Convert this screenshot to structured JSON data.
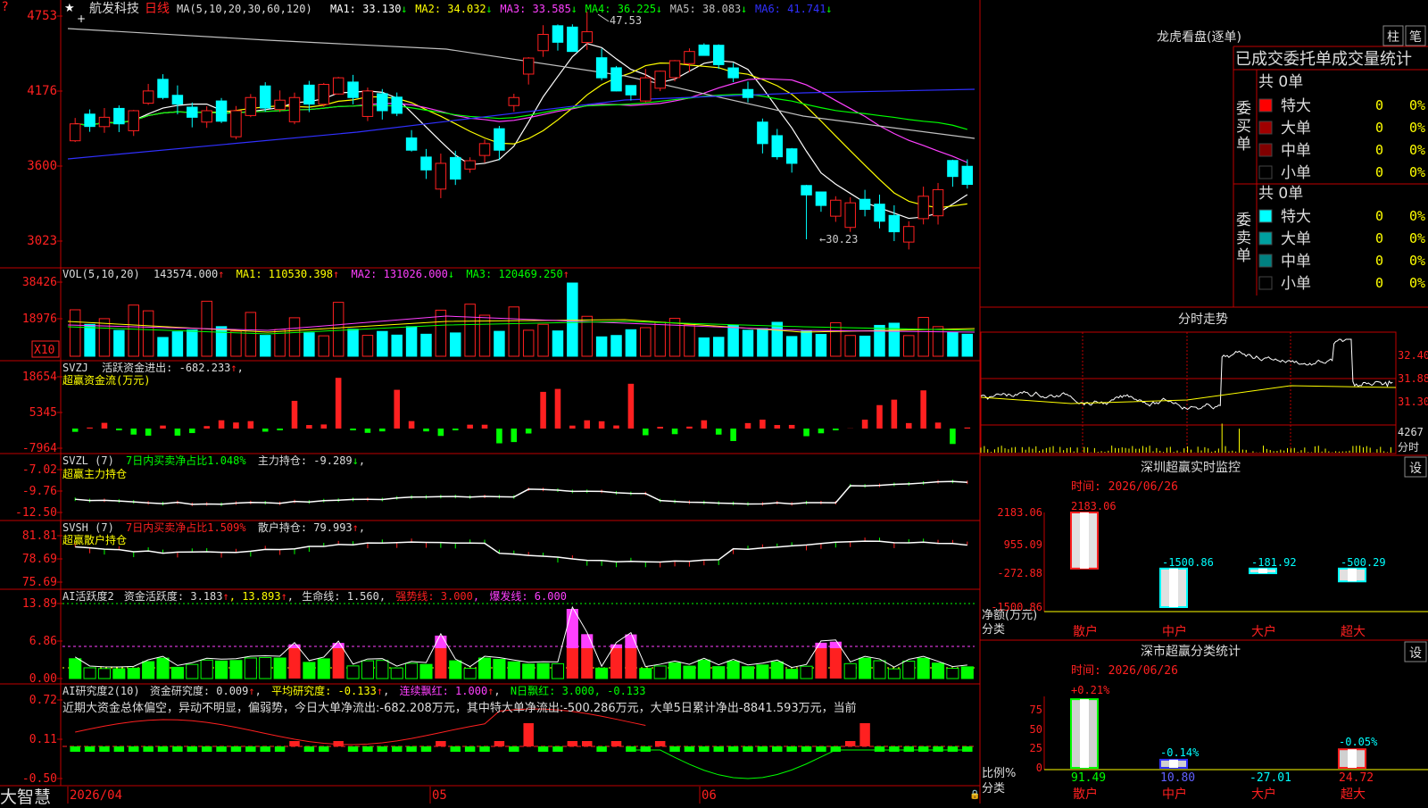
{
  "colors": {
    "up": "#ff2020",
    "down": "#00ffff",
    "grid": "#c00000",
    "ma1": "#ffffff",
    "ma2": "#ffff00",
    "ma3": "#ff40ff",
    "ma4": "#00ff00",
    "ma5": "#c0c0c0",
    "ma6": "#3030ff",
    "orange": "#ff8000"
  },
  "stock": {
    "name": "航发科技",
    "period": "日线",
    "ma_header": "MA(5,10,20,30,60,120)",
    "ma_values": [
      {
        "label": "MA1:",
        "value": "33.130"
      },
      {
        "label": "MA2:",
        "value": "34.032"
      },
      {
        "label": "MA3:",
        "value": "33.585"
      },
      {
        "label": "MA4:",
        "value": "36.225"
      },
      {
        "label": "MA5:",
        "value": "38.083"
      },
      {
        "label": "MA6:",
        "value": "41.741"
      }
    ],
    "high_note": "47.53",
    "low_note": "←30.23",
    "y_ticks": [
      "4753",
      "4176",
      "3600",
      "3023"
    ]
  },
  "vol": {
    "header": "VOL(5,10,20)",
    "value": "143574.000",
    "ma1": "MA1: 110530.398",
    "ma2": "MA2: 131026.000",
    "ma3": "MA3: 120469.250",
    "y_ticks": [
      "38426",
      "18976"
    ],
    "unit": "X10"
  },
  "svzj": {
    "header": "SVZJ",
    "label": "活跃资金进出: -682.233",
    "sub": "超赢资金流(万元)",
    "y_ticks": [
      "18654",
      "5345",
      "-7964"
    ]
  },
  "svzl": {
    "header": "SVZL (7)",
    "pct": "7日内买卖净占比1.048%",
    "main": "主力持仓: -9.289",
    "sub": "超赢主力持仓",
    "y_ticks": [
      "-7.02",
      "-9.76",
      "-12.50"
    ]
  },
  "svsh": {
    "header": "SVSH (7)",
    "pct": "7日内买卖净占比1.509%",
    "retail": "散户持仓: 79.993",
    "sub": "超赢散户持仓",
    "y_ticks": [
      "81.81",
      "78.69",
      "75.69"
    ]
  },
  "ai1": {
    "header": "AI活跃度2",
    "act": "资金活跃度: 3.183",
    "v2": "13.893",
    "life": "生命线: 1.560",
    "strong": "强势线: 3.000",
    "burst": "爆发线: 6.000",
    "y_ticks": [
      "13.89",
      "6.86",
      "0.00"
    ]
  },
  "ai2": {
    "header": "AI研究度2(10)",
    "res": "资金研究度: 0.009",
    "avg": "平均研究度: -0.133",
    "cont": "连续飘红: 1.000",
    "nday": "N日飘红: 3.000, -0.133",
    "comment": "近期大资金总体偏空，异动不明显，偏弱势，今日大单净流出:-682.208万元，其中特大单净流出:-500.286万元，大单5日累计净出-8841.593万元，当前",
    "y_ticks": [
      "0.72",
      "0.11",
      "-0.50"
    ]
  },
  "dates": [
    "2026/04",
    "05",
    "06"
  ],
  "bottom_label": "大智慧",
  "lhb": {
    "title": "龙虎看盘(逐单)",
    "btn1": "柱",
    "btn2": "笔",
    "tab": "已成交委托单成交量统计",
    "buy_side": "委买单",
    "sell_side": "委卖单",
    "total": "共 0单",
    "rows": [
      {
        "name": "特大",
        "count": "0",
        "pct": "0%",
        "color": "#ff0000"
      },
      {
        "name": "大单",
        "count": "0",
        "pct": "0%",
        "color": "#a00000"
      },
      {
        "name": "中单",
        "count": "0",
        "pct": "0%",
        "color": "#800000"
      },
      {
        "name": "小单",
        "count": "0",
        "pct": "0%",
        "color": "#000000"
      }
    ],
    "sell_rows": [
      {
        "name": "特大",
        "count": "0",
        "pct": "0%",
        "color": "#00ffff"
      },
      {
        "name": "大单",
        "count": "0",
        "pct": "0%",
        "color": "#00a0a0"
      },
      {
        "name": "中单",
        "count": "0",
        "pct": "0%",
        "color": "#008080"
      },
      {
        "name": "小单",
        "count": "0",
        "pct": "0%",
        "color": "#000000"
      }
    ]
  },
  "intraday": {
    "title": "分时走势",
    "y_ticks": [
      "32.40",
      "31.88",
      "31.30"
    ],
    "vol_tick": "4267",
    "vol_label": "分时"
  },
  "monitor": {
    "title": "深圳超赢实时监控",
    "btn": "设",
    "time": "时间: 2026/06/26",
    "y_ticks": [
      "2183.06",
      "955.09",
      "-272.88",
      "-1500.86"
    ],
    "ylabel": "净额(万元)",
    "xlabel": "分类",
    "bars": [
      {
        "cat": "散户",
        "value": 2183.06,
        "label": "2183.06"
      },
      {
        "cat": "中户",
        "value": -1500.86,
        "label": "-1500.86"
      },
      {
        "cat": "大户",
        "value": -181.92,
        "label": "-181.92"
      },
      {
        "cat": "超大",
        "value": -500.29,
        "label": "-500.29"
      }
    ]
  },
  "classify": {
    "title": "深市超赢分类统计",
    "btn": "设",
    "time": "时间: 2026/06/26",
    "y_ticks": [
      "75",
      "50",
      "25",
      "0"
    ],
    "ylabel": "比例%",
    "xlabel": "分类",
    "bars": [
      {
        "cat": "散户",
        "value": 91.49,
        "label": "91.49",
        "pct": "+0.21%"
      },
      {
        "cat": "中户",
        "value": 10.8,
        "label": "10.80",
        "pct": "-0.14%"
      },
      {
        "cat": "大户",
        "value": -27.01,
        "label": "-27.01",
        "pct": ""
      },
      {
        "cat": "超大",
        "value": 24.72,
        "label": "24.72",
        "pct": "-0.05%"
      }
    ]
  }
}
